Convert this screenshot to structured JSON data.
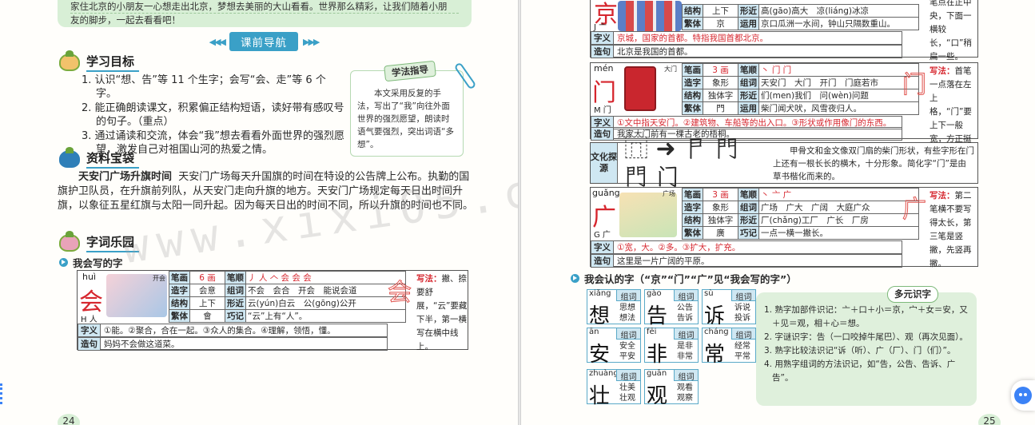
{
  "left_page": {
    "intro_text_1": "家住北京的小朋友一心想走出北京，梦想去美丽的大山看看。世界那么精彩，让我们随着小朋",
    "intro_text_2": "友的脚步，一起去看看吧！",
    "banner": "课前导航",
    "goals_title": "学习目标",
    "goals": [
      "1. 认识“想、告”等 11 个生字；会写“会、走”等 6 个字。",
      "2. 能正确朗读课文，积累偏正结构短语，读好带有感叹号的句子。（重点）",
      "3. 通过诵读和交流，体会“我”想去看看外面世界的强烈愿望，激发自己对祖国山河的热爱之情。"
    ],
    "method_tag": "学法指导",
    "method_text": "本文采用反复的手法，写出了“我”向往外面世界的强烈愿望，朗读时语气要强烈，突出词语“多想”。",
    "resource_title": "资料宝袋",
    "resource_bold": "天安门广场升旗时间",
    "resource_text": "天安门广场每天升国旗的时间在特设的公告牌上公布。执勤的国旗护卫队员，在升旗前列队，从天安门走向升旗的地方。天安门广场规定每天日出时间升旗，以象征五星红旗与太阳一同升起。因为每天日出的时间不同，所以升旗的时间也不同。",
    "words_title": "字词乐园",
    "write_title": "我会写的字",
    "hui": {
      "pinyin": "huì",
      "char": "会",
      "radical": "H 人",
      "img_label": "开会",
      "rows": [
        [
          "笔画",
          "6 画",
          "笔顺",
          "丿 人 𠆢 会 会 会"
        ],
        [
          "造字",
          "会意",
          "组词",
          "不会　会合　开会　能说会道"
        ],
        [
          "结构",
          "上下",
          "形近",
          "云(yún)白云　公(gōng)公开"
        ],
        [
          "繁体",
          "會",
          "巧记",
          "“云”上有“人”。"
        ]
      ],
      "meaning": "①能。②聚合，合在一起。③众人的集合。④理解，领悟，懂。",
      "sentence": "妈妈不会做这道菜。",
      "write_label": "写法：",
      "write_note": "撇、捺要舒展，“云”要藏下半，第一横写在横中线上。"
    },
    "page_number": "24"
  },
  "right_page": {
    "jing_partial": {
      "char": "京",
      "radical": "J 亠",
      "rows": [
        [
          "结构",
          "上下",
          "形近",
          "高(gāo)高大　凉(liáng)冰凉"
        ],
        [
          "繁体",
          "京",
          "运用",
          "京口瓜洲一水间，钟山只隔数重山。"
        ]
      ],
      "meaning": "京城，国家的首都。特指我国首都北京。",
      "sentence": "北京是我国的首都。",
      "write_note": "笔点在正中央，下面一横较长，“口”稍扁一些。"
    },
    "men": {
      "pinyin": "mén",
      "char": "门",
      "radical": "M 门",
      "img_label": "大门",
      "rows": [
        [
          "笔画",
          "3 画",
          "笔顺",
          "丶 门 门"
        ],
        [
          "造字",
          "象形",
          "组词",
          "天安门　大门　开门　门庭若市"
        ],
        [
          "结构",
          "独体字",
          "形近",
          "们(men)我们　问(wèn)问题"
        ],
        [
          "繁体",
          "門",
          "运用",
          "柴门闻犬吠，风雪夜归人。"
        ]
      ],
      "meaning": "①文中指天安门。②建筑物、车船等的出入口。③形状或作用像门的东西。",
      "sentence": "我家大门前有一棵古老的梧桐。",
      "write_label": "写法：",
      "write_note": "首笔一点落在左上格，“门”要上下一般宽，方正挺拔。"
    },
    "culture": {
      "label": "文化探源",
      "glyphs": "⿵ ➜ 𠁣 門 門 门",
      "text": "甲骨文和金文像双门扇的柴门形状，有些字形在门上还有一根长长的横木，十分形象。简化字“门”是由草书楷化而来的。"
    },
    "guang": {
      "pinyin": "guǎng",
      "char": "广",
      "radical": "G 广",
      "img_label": "广场",
      "rows": [
        [
          "笔画",
          "3 画",
          "笔顺",
          "丶 亠 广"
        ],
        [
          "造字",
          "象形",
          "组词",
          "广场　广大　广阔　大庭广众"
        ],
        [
          "结构",
          "独体字",
          "形近",
          "厂(chǎng)工厂　广长　厂房"
        ],
        [
          "繁体",
          "廣",
          "巧记",
          "一点一横一撇长。"
        ]
      ],
      "meaning": "①宽，大。②多。③扩大，扩充。",
      "sentence": "这里是一片广阔的平原。",
      "write_label": "写法：",
      "write_note": "第二笔横不要写得太长，第三笔是竖撇，先竖再撇。"
    },
    "recognize_title": "我会认的字（“京”“门”“广”见“我会写的字”）",
    "recognize": [
      {
        "py": "xiǎng",
        "c": "想",
        "w": "思想 想法"
      },
      {
        "py": "gào",
        "c": "告",
        "w": "公告 告诉"
      },
      {
        "py": "sù",
        "c": "诉",
        "w": "诉说 投诉"
      },
      {
        "py": "ān",
        "c": "安",
        "w": "安全 平安"
      },
      {
        "py": "fēi",
        "c": "非",
        "w": "是非 非常"
      },
      {
        "py": "cháng",
        "c": "常",
        "w": "经常 平常"
      },
      {
        "py": "zhuàng",
        "c": "壮",
        "w": "壮美 壮观"
      },
      {
        "py": "guān",
        "c": "观",
        "w": "观看 观察"
      }
    ],
    "recognize_label": "组词",
    "multi_tag": "多元识字",
    "multi": [
      "1. 熟字加部件识记：亠＋口＋小＝京，宀＋女＝安，又＋见＝观，相＋心＝想。",
      "2. 字谜识字：告（一口咬掉牛尾巴）、观（再次见面）。",
      "3. 熟字比较法识记“诉（听）、广（厂）、门（们）”。",
      "4. 用熟字组词的方法识记，如“告，公告、告诉、广告”。"
    ],
    "page_number": "25"
  },
  "watermark": "www.xixi05.com",
  "colors": {
    "accent": "#3aa0c7",
    "red": "#d6262e",
    "green_bg": "#d8efd6",
    "header_cell": "#cfe7f2"
  }
}
